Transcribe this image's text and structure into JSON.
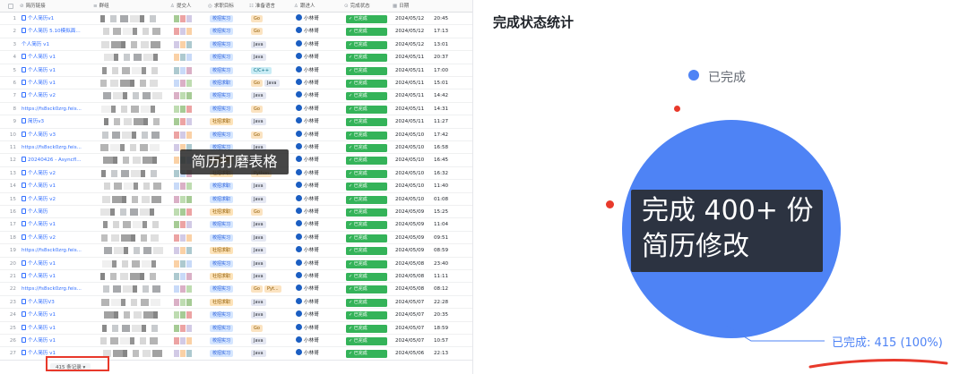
{
  "table": {
    "columns": [
      "简历链接",
      "群组",
      "提交人",
      "求职目标",
      "准备语言",
      "跟进人",
      "完成状态",
      "日期"
    ],
    "rows": [
      {
        "n": "1",
        "link": "个人简历v1",
        "doc": true,
        "goal": "校招实习",
        "goal_type": "school",
        "langs": [
          "Go"
        ],
        "owner": "小林哥",
        "status": "已完成",
        "date": "2024/05/12",
        "time": "20:45"
      },
      {
        "n": "2",
        "link": "个人简历 5.10模拟面...",
        "doc": true,
        "goal": "校招实习",
        "goal_type": "school",
        "langs": [
          "Go"
        ],
        "owner": "小林哥",
        "status": "已完成",
        "date": "2024/05/12",
        "time": "17:13"
      },
      {
        "n": "3",
        "link": "个人简历 v1",
        "doc": false,
        "goal": "校招实习",
        "goal_type": "school",
        "langs": [
          "Java"
        ],
        "owner": "小林哥",
        "status": "已完成",
        "date": "2024/05/12",
        "time": "13:01"
      },
      {
        "n": "4",
        "link": "个人简历 v1",
        "doc": true,
        "goal": "校招实习",
        "goal_type": "school",
        "langs": [
          "Java"
        ],
        "owner": "小林哥",
        "status": "已完成",
        "date": "2024/05/11",
        "time": "20:37"
      },
      {
        "n": "5",
        "link": "个人简历 v1",
        "doc": true,
        "goal": "校招实习",
        "goal_type": "school",
        "langs": [
          "C/C++"
        ],
        "owner": "小林哥",
        "status": "已完成",
        "date": "2024/05/11",
        "time": "17:00"
      },
      {
        "n": "6",
        "link": "个人简历 v1",
        "doc": true,
        "goal": "校招求职",
        "goal_type": "school",
        "langs": [
          "Go",
          "Java"
        ],
        "owner": "小林哥",
        "status": "已完成",
        "date": "2024/05/11",
        "time": "15:01"
      },
      {
        "n": "7",
        "link": "个人简历 v2",
        "doc": true,
        "goal": "校招实习",
        "goal_type": "school",
        "langs": [
          "Java"
        ],
        "owner": "小林哥",
        "status": "已完成",
        "date": "2024/05/11",
        "time": "14:42"
      },
      {
        "n": "8",
        "link": "https://fs8sck0zrg.feis...",
        "doc": false,
        "goal": "校招实习",
        "goal_type": "school",
        "langs": [
          "Go"
        ],
        "owner": "小林哥",
        "status": "已完成",
        "date": "2024/05/11",
        "time": "14:31"
      },
      {
        "n": "9",
        "link": "简历v3",
        "doc": true,
        "goal": "社招求职",
        "goal_type": "society",
        "langs": [
          "Java"
        ],
        "owner": "小林哥",
        "status": "已完成",
        "date": "2024/05/11",
        "time": "11:27"
      },
      {
        "n": "10",
        "link": "个人简历 v3",
        "doc": true,
        "goal": "校招实习",
        "goal_type": "school",
        "langs": [
          "Go"
        ],
        "owner": "小林哥",
        "status": "已完成",
        "date": "2024/05/10",
        "time": "17:42"
      },
      {
        "n": "11",
        "link": "https://fs8sck0zrg.feis...",
        "doc": false,
        "goal": "校招实习",
        "goal_type": "school",
        "langs": [
          "Java"
        ],
        "owner": "小林哥",
        "status": "已完成",
        "date": "2024/05/10",
        "time": "16:58"
      },
      {
        "n": "12",
        "link": "20240426 - Asyncfl...",
        "doc": true,
        "goal": "社招求职",
        "goal_type": "society",
        "langs": [
          "Java"
        ],
        "owner": "小林哥",
        "status": "已完成",
        "date": "2024/05/10",
        "time": "16:45"
      },
      {
        "n": "13",
        "link": "个人简历 v2",
        "doc": true,
        "goal": "社招求职",
        "goal_type": "society",
        "langs": [
          "Python"
        ],
        "owner": "小林哥",
        "status": "已完成",
        "date": "2024/05/10",
        "time": "16:32"
      },
      {
        "n": "14",
        "link": "个人简历 v1",
        "doc": true,
        "goal": "校招求职",
        "goal_type": "school",
        "langs": [
          "Java"
        ],
        "owner": "小林哥",
        "status": "已完成",
        "date": "2024/05/10",
        "time": "11:40"
      },
      {
        "n": "15",
        "link": "个人简历 v2",
        "doc": true,
        "goal": "校招求职",
        "goal_type": "school",
        "langs": [
          "Java"
        ],
        "owner": "小林哥",
        "status": "已完成",
        "date": "2024/05/10",
        "time": "01:08"
      },
      {
        "n": "16",
        "link": "个人简历",
        "doc": true,
        "goal": "社招求职",
        "goal_type": "society",
        "langs": [
          "Go"
        ],
        "owner": "小林哥",
        "status": "已完成",
        "date": "2024/05/09",
        "time": "15:25"
      },
      {
        "n": "17",
        "link": "个人简历 v1",
        "doc": true,
        "goal": "校招实习",
        "goal_type": "school",
        "langs": [
          "Java"
        ],
        "owner": "小林哥",
        "status": "已完成",
        "date": "2024/05/09",
        "time": "11:04"
      },
      {
        "n": "18",
        "link": "个人简历 v2",
        "doc": true,
        "goal": "校招实习",
        "goal_type": "school",
        "langs": [
          "Java"
        ],
        "owner": "小林哥",
        "status": "已完成",
        "date": "2024/05/09",
        "time": "09:51"
      },
      {
        "n": "19",
        "link": "https://fs8sck0zrg.feis...",
        "doc": false,
        "goal": "社招求职",
        "goal_type": "society",
        "langs": [
          "Java"
        ],
        "owner": "小林哥",
        "status": "已完成",
        "date": "2024/05/09",
        "time": "08:59"
      },
      {
        "n": "20",
        "link": "个人简历 v1",
        "doc": true,
        "goal": "校招实习",
        "goal_type": "school",
        "langs": [
          "Java"
        ],
        "owner": "小林哥",
        "status": "已完成",
        "date": "2024/05/08",
        "time": "23:40"
      },
      {
        "n": "21",
        "link": "个人简历 v1",
        "doc": true,
        "goal": "社招求职",
        "goal_type": "society",
        "langs": [
          "Java"
        ],
        "owner": "小林哥",
        "status": "已完成",
        "date": "2024/05/08",
        "time": "11:11"
      },
      {
        "n": "22",
        "link": "https://fs8sck0zrg.feis...",
        "doc": false,
        "goal": "校招实习",
        "goal_type": "school",
        "langs": [
          "Go",
          "Pyt..."
        ],
        "owner": "小林哥",
        "status": "已完成",
        "date": "2024/05/08",
        "time": "08:12"
      },
      {
        "n": "23",
        "link": "个人简历V3",
        "doc": true,
        "goal": "社招求职",
        "goal_type": "society",
        "langs": [
          "Java"
        ],
        "owner": "小林哥",
        "status": "已完成",
        "date": "2024/05/07",
        "time": "22:28"
      },
      {
        "n": "24",
        "link": "个人简历 v1",
        "doc": true,
        "goal": "校招实习",
        "goal_type": "school",
        "langs": [
          "Java"
        ],
        "owner": "小林哥",
        "status": "已完成",
        "date": "2024/05/07",
        "time": "20:35"
      },
      {
        "n": "25",
        "link": "个人简历 v1",
        "doc": true,
        "goal": "校招实习",
        "goal_type": "school",
        "langs": [
          "Go"
        ],
        "owner": "小林哥",
        "status": "已完成",
        "date": "2024/05/07",
        "time": "18:59"
      },
      {
        "n": "26",
        "link": "个人简历 v1",
        "doc": true,
        "goal": "校招实习",
        "goal_type": "school",
        "langs": [
          "Java"
        ],
        "owner": "小林哥",
        "status": "已完成",
        "date": "2024/05/07",
        "time": "10:57"
      },
      {
        "n": "27",
        "link": "个人简历 v1",
        "doc": true,
        "goal": "校招实习",
        "goal_type": "school",
        "langs": [
          "Java"
        ],
        "owner": "小林哥",
        "status": "已完成",
        "date": "2024/05/06",
        "time": "22:13"
      }
    ],
    "record_count_label": "415 条记录",
    "overlay_text": "简历打磨表格"
  },
  "chart_panel": {
    "title": "完成状态统计",
    "overlay_line1": "完成 400+ 份",
    "overlay_line2": "简历修改"
  },
  "chart_data": {
    "type": "pie",
    "title": "完成状态统计",
    "categories": [
      "已完成"
    ],
    "values": [
      415
    ],
    "data_labels": [
      "已完成: 415 (100%)"
    ],
    "legend": [
      "已完成"
    ],
    "legend_placement": "top",
    "colors": {
      "已完成": "#4e83f5"
    }
  },
  "colors": {
    "accent_blue": "#3370ff",
    "status_green": "#34b359",
    "pie_blue": "#4e83f5",
    "annotation_red": "#e8392b"
  }
}
